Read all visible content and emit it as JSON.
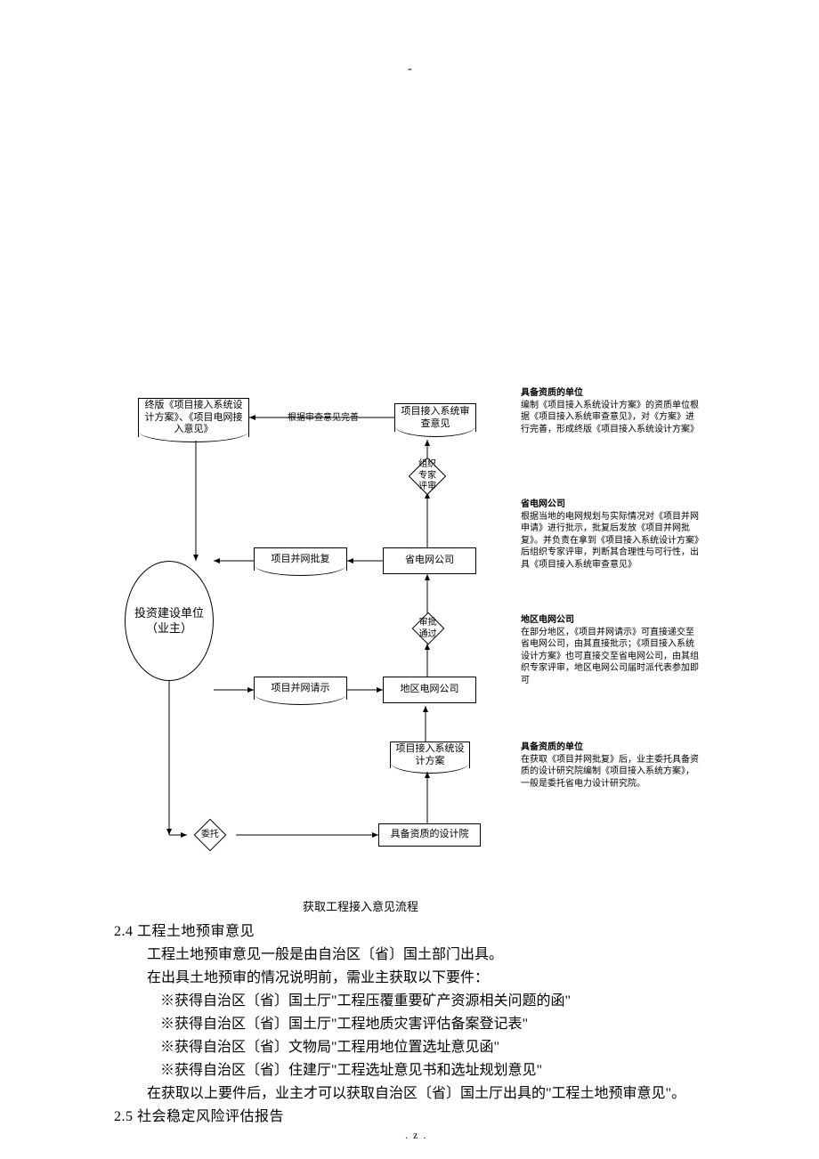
{
  "flow": {
    "caption": "获取工程接入意见流程",
    "nodes": {
      "final_doc": "终版《项目接入系统设计方案》、《项目电网接入意见》",
      "review_opinion": "项目接入系统审查意见",
      "expert_review": "组织专家评审",
      "approval": "项目并网批复",
      "provincial": "省电网公司",
      "approve_pass": "审批通过",
      "request": "项目并网请示",
      "regional": "地区电网公司",
      "design_plan": "项目接入系统设计方案",
      "commission": "委托",
      "design_inst": "具备资质的设计院",
      "owner": "投资建设单位（业主）",
      "edge_improve": "根据审查意见完善"
    },
    "annot": {
      "a1_title": "具备资质的单位",
      "a1_body": "编制《项目接入系统设计方案》的资质单位根据《项目接入系统审查意见》，对《方案》进行完善，形成终版《项目接入系统设计方案》",
      "a2_title": "省电网公司",
      "a2_body": "根据当地的电网规划与实际情况对《项目并网申请》进行批示，批复后发放《项目并网批复》。并负责在拿到《项目接入系统设计方案》后组织专家评审，判断其合理性与可行性，出具《项目接入系统审查意见》",
      "a3_title": "地区电网公司",
      "a3_body": "在部分地区，《项目并网请示》可直接递交至省电网公司，由其直接批示；《项目接入系统设计方案》也可直接交至省电网公司，由其组织专家评审，地区电网公司届时派代表参加即可",
      "a4_title": "具备资质的单位",
      "a4_body": "在获取《项目并网批复》后，业主委托具备资质的设计研究院编制《项目接入系统方案》，一般是委托省电力设计研究院。"
    }
  },
  "text": {
    "h24": "2.4 工程土地预审意见",
    "l1": "工程土地预审意见一般是由自治区〔省〕国土部门出具。",
    "l2": "在出具土地预审的情况说明前，需业主获取以下要件：",
    "l3": "※获得自治区〔省〕国土厅\"工程压覆重要矿产资源相关问题的函\"",
    "l4": "※获得自治区〔省〕国土厅\"工程地质灾害评估备案登记表\"",
    "l5": "※获得自治区〔省〕文物局\"工程用地位置选址意见函\"",
    "l6": "※获得自治区〔省〕住建厅\"工程选址意见书和选址规划意见\"",
    "l7": "在获取以上要件后，业主才可以获取自治区〔省〕国土厅出具的\"工程土地预审意见\"。",
    "h25": "2.5 社会稳定风险评估报告"
  },
  "footer": ".z."
}
